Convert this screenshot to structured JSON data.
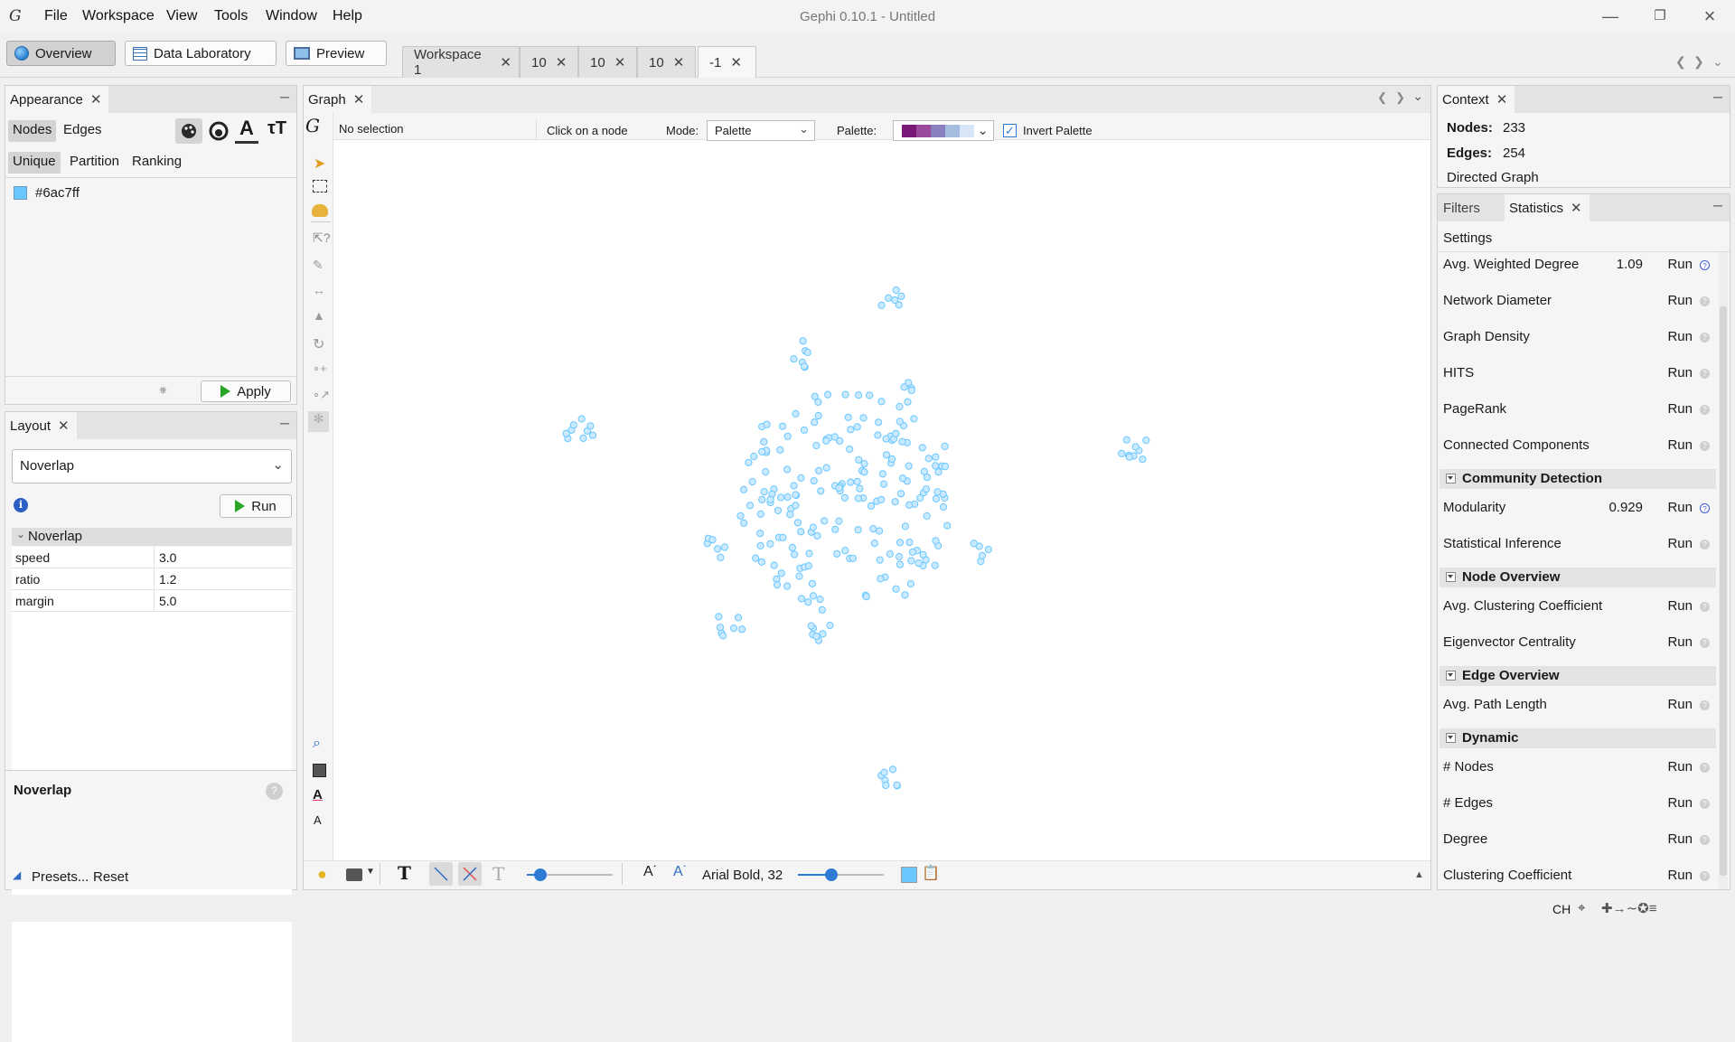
{
  "app": {
    "title": "Gephi 0.10.1 - Untitled"
  },
  "menu": [
    "File",
    "Workspace",
    "View",
    "Tools",
    "Window",
    "Help"
  ],
  "modes": {
    "overview": "Overview",
    "data_lab": "Data Laboratory",
    "preview": "Preview"
  },
  "workspace_tabs": [
    "Workspace 1",
    "10",
    "10",
    "10",
    "-1"
  ],
  "appearance": {
    "title": "Appearance",
    "target_tabs": [
      "Nodes",
      "Edges"
    ],
    "mode_tabs": [
      "Unique",
      "Partition",
      "Ranking"
    ],
    "color_hex": "#6ac7ff",
    "color_label": "#6ac7ff",
    "apply_label": "Apply"
  },
  "layout": {
    "title": "Layout",
    "algorithm": "Noverlap",
    "run_label": "Run",
    "section": "Noverlap",
    "props": [
      {
        "name": "speed",
        "value": "3.0"
      },
      {
        "name": "ratio",
        "value": "1.2"
      },
      {
        "name": "margin",
        "value": "5.0"
      }
    ],
    "description_title": "Noverlap",
    "presets_label": "Presets...",
    "reset_label": "Reset"
  },
  "graph": {
    "tab": "Graph",
    "selection": "No selection",
    "hint": "Click on a node",
    "mode_label": "Mode:",
    "mode_value": "Palette",
    "palette_label": "Palette:",
    "palette_colors": [
      "#7a1877",
      "#9a4a9a",
      "#8a80c0",
      "#a6bde0",
      "#d6e6f6"
    ],
    "invert_label": "Invert Palette",
    "invert_checked": true,
    "font_label": "Arial Bold, 32",
    "node_color": "#6ac7ff",
    "accent": "#2e7bd6"
  },
  "context": {
    "title": "Context",
    "nodes_label": "Nodes:",
    "nodes_value": "233",
    "edges_label": "Edges:",
    "edges_value": "254",
    "graph_type": "Directed Graph"
  },
  "stats": {
    "tabs": [
      "Filters",
      "Statistics"
    ],
    "settings_label": "Settings",
    "run_label": "Run",
    "rows_network": [
      {
        "label": "Avg. Weighted Degree",
        "value": "1.09",
        "help": "blue"
      },
      {
        "label": "Network Diameter",
        "value": "",
        "help": "grey"
      },
      {
        "label": "Graph Density",
        "value": "",
        "help": "grey"
      },
      {
        "label": "HITS",
        "value": "",
        "help": "grey"
      },
      {
        "label": "PageRank",
        "value": "",
        "help": "grey"
      },
      {
        "label": "Connected Components",
        "value": "",
        "help": "grey"
      }
    ],
    "community_title": "Community Detection",
    "rows_community": [
      {
        "label": "Modularity",
        "value": "0.929",
        "help": "blue"
      },
      {
        "label": "Statistical Inference",
        "value": "",
        "help": "grey"
      }
    ],
    "node_title": "Node Overview",
    "rows_node": [
      {
        "label": "Avg. Clustering Coefficient",
        "value": "",
        "help": "grey"
      },
      {
        "label": "Eigenvector Centrality",
        "value": "",
        "help": "grey"
      }
    ],
    "edge_title": "Edge Overview",
    "rows_edge": [
      {
        "label": "Avg. Path Length",
        "value": "",
        "help": "grey"
      }
    ],
    "dynamic_title": "Dynamic",
    "rows_dynamic": [
      {
        "label": "# Nodes",
        "value": "",
        "help": "grey"
      },
      {
        "label": "# Edges",
        "value": "",
        "help": "grey"
      },
      {
        "label": "Degree",
        "value": "",
        "help": "grey"
      },
      {
        "label": "Clustering Coefficient",
        "value": "",
        "help": "grey"
      }
    ]
  },
  "taskbar": {
    "ime": "CH"
  }
}
